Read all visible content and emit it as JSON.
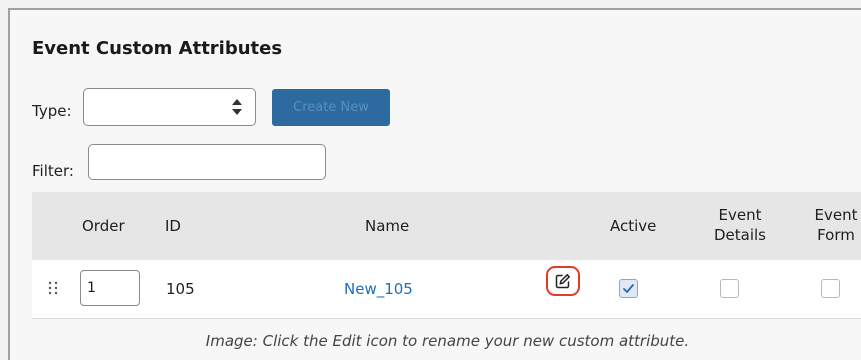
{
  "panel": {
    "title": "Event Custom Attributes"
  },
  "type_field": {
    "label": "Type:",
    "value": ""
  },
  "create_button": {
    "label": "Create New"
  },
  "filter_field": {
    "label": "Filter:",
    "value": ""
  },
  "table": {
    "headers": {
      "order": "Order",
      "id": "ID",
      "name": "Name",
      "active": "Active",
      "event_details": [
        "Event",
        "Details"
      ],
      "event_form": [
        "Event",
        "Form"
      ]
    },
    "rows": [
      {
        "order": "1",
        "id": "105",
        "name": "New_105",
        "active": true,
        "event_details": false,
        "event_form": false
      }
    ]
  },
  "caption": "Image: Click the Edit icon to rename your new custom attribute.",
  "colors": {
    "accent": "#2c6aa0",
    "link": "#1f6fb8",
    "highlight": "#e23b2a"
  },
  "icons": {
    "drag": "drag-handle-icon",
    "edit": "edit-icon",
    "select": "select-arrows-icon",
    "check": "checkmark-icon"
  }
}
